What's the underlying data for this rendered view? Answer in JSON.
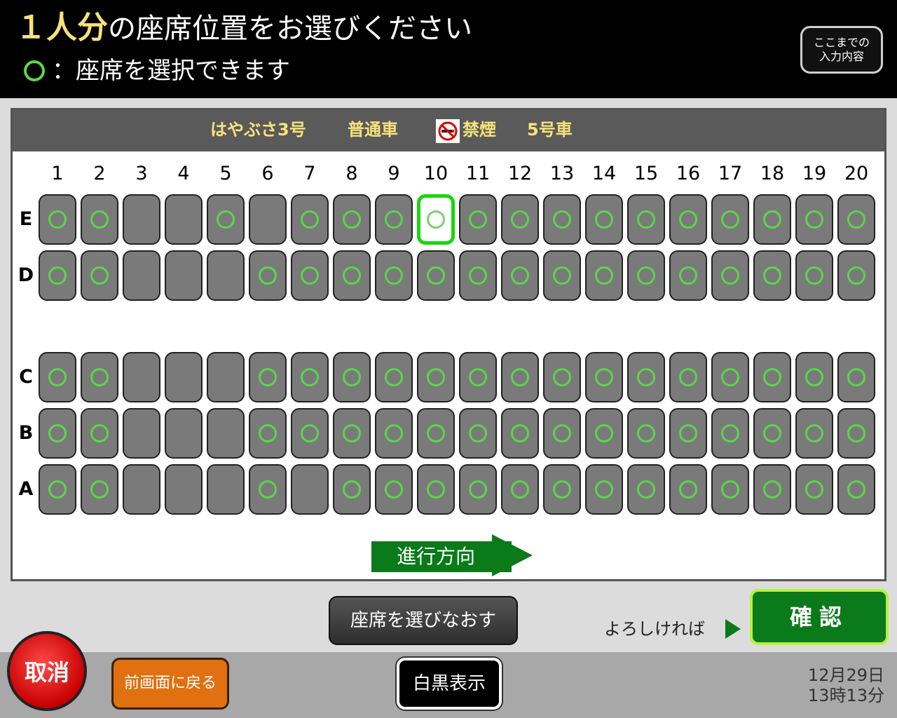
{
  "header": {
    "title_count": "１人分",
    "title_rest": "の座席位置をお選びください",
    "subtitle": "：座席を選択できます",
    "summary_button": {
      "line1": "ここまでの",
      "line2": "入力内容"
    }
  },
  "train": {
    "name": "はやぶさ3号",
    "car_class": "普通車",
    "smoking": "禁煙",
    "car_number": "5号車"
  },
  "seat_map": {
    "columns": [
      "1",
      "2",
      "3",
      "4",
      "5",
      "6",
      "7",
      "8",
      "9",
      "10",
      "11",
      "12",
      "13",
      "14",
      "15",
      "16",
      "17",
      "18",
      "19",
      "20"
    ],
    "rows": [
      {
        "label": "E",
        "unavailable": [
          3,
          4,
          6
        ],
        "selected": [
          10
        ]
      },
      {
        "label": "D",
        "unavailable": [
          3,
          4,
          5
        ],
        "selected": []
      },
      {
        "label": "C",
        "unavailable": [
          3,
          4,
          5
        ],
        "selected": []
      },
      {
        "label": "B",
        "unavailable": [
          3,
          4,
          5
        ],
        "selected": []
      },
      {
        "label": "A",
        "unavailable": [
          3,
          4,
          5,
          7
        ],
        "selected": []
      }
    ],
    "direction_label": "進行方向",
    "available_color": "#5ad64a",
    "selected_color": "#18d60c"
  },
  "actions": {
    "reselect": "座席を選びなおす",
    "ok_hint": "よろしければ",
    "confirm": "確認"
  },
  "footer": {
    "cancel": "取消",
    "back": "前画面に戻る",
    "monochrome": "白黒表示",
    "date": "12月29日",
    "time": "13時13分"
  }
}
